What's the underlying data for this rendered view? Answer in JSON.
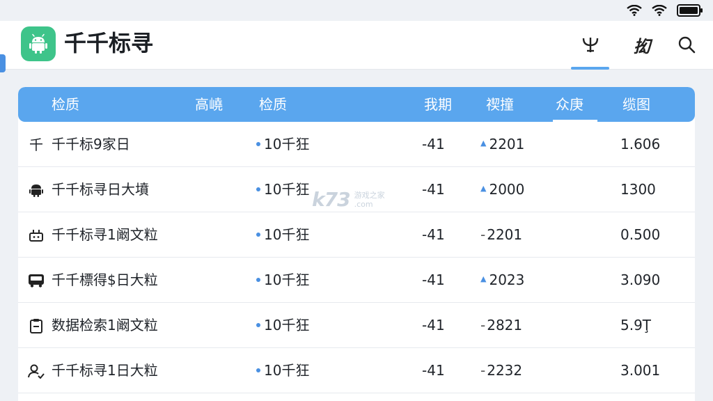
{
  "app": {
    "title": "千千标寻",
    "logo_icon": "android-icon",
    "brand_color": "#3ec48a",
    "accent_color": "#5aa6ee"
  },
  "status_bar": {
    "icons": [
      "wifi-icon",
      "wifi-icon",
      "battery-icon"
    ]
  },
  "toolbar": {
    "actions": [
      {
        "icon": "antenna-icon",
        "label": ""
      },
      {
        "icon": "filter-icon",
        "label": "抝"
      },
      {
        "icon": "search-icon",
        "label": ""
      }
    ]
  },
  "table": {
    "headers": [
      "检质",
      "高嶢",
      "检质",
      "我期",
      "禊撞",
      "众庚",
      "缆图"
    ],
    "rows": [
      {
        "icon": "text-glyph",
        "icon_text": "千",
        "name": "千千标9家日",
        "tag": "10千狂",
        "col4": "-41",
        "trend": "up",
        "col5": "2201",
        "col7": "1.606"
      },
      {
        "icon": "android-icon",
        "icon_text": "",
        "name": "千千标寻日大墳",
        "tag": "10千狂",
        "col4": "-41",
        "trend": "up",
        "col5": "2000",
        "col7": "1300"
      },
      {
        "icon": "robot-icon",
        "icon_text": "",
        "name": "千千标寻1阚文粒",
        "tag": "10千狂",
        "col4": "-41",
        "trend": "down",
        "col5": "2201",
        "col7": "0.500"
      },
      {
        "icon": "bus-icon",
        "icon_text": "",
        "name": "千千標得$日大粒",
        "tag": "10千狂",
        "col4": "-41",
        "trend": "up",
        "col5": "2023",
        "col7": "3.090"
      },
      {
        "icon": "clipboard-icon",
        "icon_text": "",
        "name": "数据检索1阚文粒",
        "tag": "10千狂",
        "col4": "-41",
        "trend": "down",
        "col5": "2821",
        "col7": "5.9Ţ"
      },
      {
        "icon": "user-icon",
        "icon_text": "",
        "name": "千千标寻1日大粒",
        "tag": "10千狂",
        "col4": "-41",
        "trend": "down",
        "col5": "2232",
        "col7": "3.001"
      }
    ]
  },
  "watermark": {
    "big": "k73",
    "line1": "游戏之家",
    "line2": ".com"
  }
}
